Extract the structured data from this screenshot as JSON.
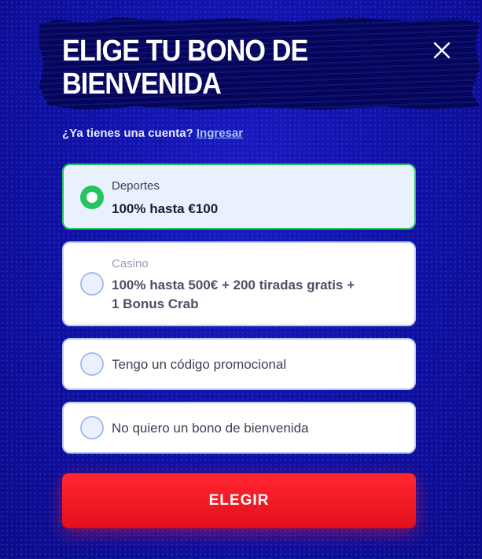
{
  "header": {
    "title": "ELIGE TU BONO DE BIENVENIDA",
    "close_icon": "close-icon"
  },
  "login": {
    "question": "¿Ya tienes una cuenta?",
    "link": "Ingresar"
  },
  "options": [
    {
      "category": "Deportes",
      "label": "100% hasta €100",
      "selected": true
    },
    {
      "category": "Casino",
      "label_line1": "100% hasta 500€ + 200 tiradas gratis +",
      "label_line2": "1 Bonus Crab",
      "selected": false
    },
    {
      "label": "Tengo un código promocional",
      "selected": false
    },
    {
      "label": "No quiero un bono de bienvenida",
      "selected": false
    }
  ],
  "cta": {
    "label": "ELEGIR"
  },
  "colors": {
    "background": "#0e0f9c",
    "selected_border": "#22c55e",
    "cta": "#ff2630",
    "link": "#a8c4ff"
  }
}
